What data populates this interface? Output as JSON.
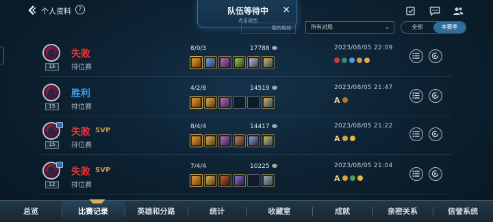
{
  "header": {
    "title": "个人资料",
    "help": "?"
  },
  "queue_popup": {
    "title": "队伍等待中",
    "subtitle": "点击返回",
    "close": "✕"
  },
  "filters": {
    "video_tab": "我的视频",
    "select_value": "所有对局",
    "segments": [
      "全部",
      "本赛季"
    ],
    "active_segment": "本赛季"
  },
  "matches": [
    {
      "result": "失败",
      "outcome": "lose",
      "svp": "",
      "mode": "排位赛",
      "level": "15",
      "badge": "",
      "kda": "8/0/3",
      "gold": "17788",
      "datetime": "2023/08/05 22:09",
      "items": [
        "#c08a2b",
        "#2e5c9a",
        "#6a2f7a",
        "#4b6b2f",
        "#3c3a55",
        "#2b4d7a"
      ],
      "medals": [
        "#c04040",
        "#3c8a6a",
        "#4aa0d8",
        "#c8a040",
        "#d8b04a"
      ]
    },
    {
      "result": "胜利",
      "outcome": "win",
      "svp": "",
      "mode": "排位赛",
      "level": "15",
      "badge": "",
      "kda": "4/2/8",
      "gold": "14519",
      "datetime": "2023/08/05 21:47",
      "items": [
        "#c08a2b",
        "#8a6a2a",
        "#6a2f7a",
        "",
        "",
        "#2b4d7a"
      ],
      "medals": [
        "A",
        "#c07030"
      ]
    },
    {
      "result": "失败",
      "outcome": "lose",
      "svp": "SVP",
      "mode": "排位赛",
      "level": "15",
      "badge": "",
      "kda": "8/4/4",
      "gold": "14417",
      "datetime": "2023/08/05 21:22",
      "items": [
        "#c08a2b",
        "#8a6a2a",
        "#6a2f7a",
        "#7a4a3a",
        "#3a6a9a",
        "#2b4d7a"
      ],
      "medals": [
        "A",
        "#d8a040",
        "#e0b848"
      ]
    },
    {
      "result": "失败",
      "outcome": "lose",
      "svp": "SVP",
      "mode": "排位赛",
      "level": "12",
      "badge": "",
      "kda": "7/4/4",
      "gold": "10225",
      "datetime": "2023/08/05 21:04",
      "items": [
        "#c08a2b",
        "#8a6a2a",
        "#8a4a2a",
        "#5a3a7a",
        "",
        "#3a4a5a"
      ],
      "medals": [
        "A",
        "#d8a040",
        "#4aa050",
        "#e0b848"
      ]
    }
  ],
  "nav": {
    "items": [
      "总览",
      "比赛记录",
      "英雄和分路",
      "统计",
      "收藏室",
      "成就",
      "亲密关系",
      "信誉系统"
    ],
    "active": "比赛记录"
  },
  "colors": {
    "lose": "#e6353a",
    "win": "#3f9be3",
    "svp": "#c79744",
    "accent": "#2f6e9b"
  }
}
